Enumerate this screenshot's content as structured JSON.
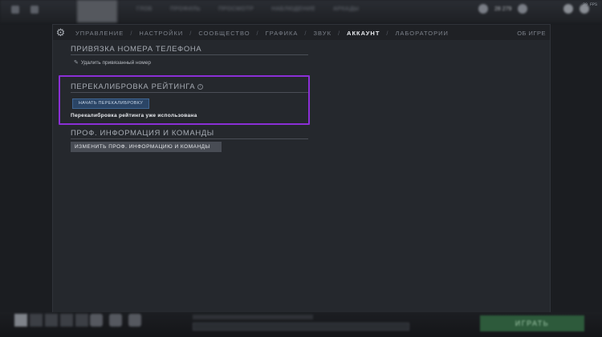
{
  "window": {
    "fps": "30 FPS",
    "top_nav": [
      "ГЛОБ",
      "ПРОФИЛЬ",
      "ПРОСМОТР",
      "НАБЛЮДЕНИЕ",
      "АРКАДЫ"
    ],
    "top_right_value": "28 279"
  },
  "settings": {
    "tabs": [
      {
        "label": "УПРАВЛЕНИЕ",
        "active": false
      },
      {
        "label": "НАСТРОЙКИ",
        "active": false
      },
      {
        "label": "СООБЩЕСТВО",
        "active": false
      },
      {
        "label": "ГРАФИКА",
        "active": false
      },
      {
        "label": "ЗВУК",
        "active": false
      },
      {
        "label": "АККАУНТ",
        "active": true
      },
      {
        "label": "ЛАБОРАТОРИИ",
        "active": false
      }
    ],
    "about_label": "ОБ ИГРЕ",
    "phone": {
      "title": "ПРИВЯЗКА НОМЕРА ТЕЛЕФОНА",
      "action": "Удалить привязанный номер"
    },
    "recalibration": {
      "title": "ПЕРЕКАЛИБРОВКА РЕЙТИНГА",
      "button": "НАЧАТЬ ПЕРЕКАЛИБРОВКУ",
      "status": "Перекалибровка рейтинга уже использована",
      "highlight_color": "#8b2fd6"
    },
    "pro": {
      "title": "ПРОФ. ИНФОРМАЦИЯ И КОМАНДЫ",
      "button": "ИЗМЕНИТЬ ПРОФ. ИНФОРМАЦИЮ И КОМАНДЫ"
    }
  },
  "bottom": {
    "play_label": "ИГРАТЬ"
  },
  "icons": {
    "gear": "gear-icon",
    "edit": "pencil-icon",
    "info": "info-icon"
  }
}
